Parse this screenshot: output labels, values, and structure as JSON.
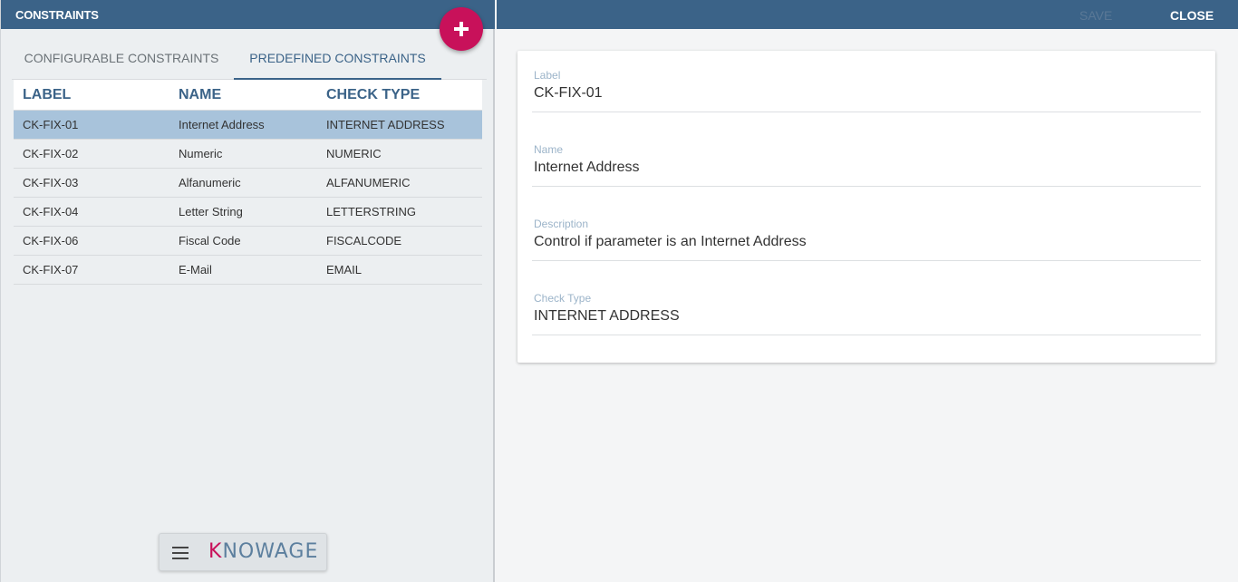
{
  "left": {
    "title": "CONSTRAINTS",
    "tabs": [
      {
        "label": "CONFIGURABLE CONSTRAINTS"
      },
      {
        "label": "PREDEFINED CONSTRAINTS"
      }
    ],
    "columns": [
      "LABEL",
      "NAME",
      "CHECK TYPE"
    ],
    "rows": [
      {
        "label": "CK-FIX-01",
        "name": "Internet Address",
        "check_type": "INTERNET ADDRESS"
      },
      {
        "label": "CK-FIX-02",
        "name": "Numeric",
        "check_type": "NUMERIC"
      },
      {
        "label": "CK-FIX-03",
        "name": "Alfanumeric",
        "check_type": "ALFANUMERIC"
      },
      {
        "label": "CK-FIX-04",
        "name": "Letter String",
        "check_type": "LETTERSTRING"
      },
      {
        "label": "CK-FIX-06",
        "name": "Fiscal Code",
        "check_type": "FISCALCODE"
      },
      {
        "label": "CK-FIX-07",
        "name": "E-Mail",
        "check_type": "EMAIL"
      }
    ],
    "logo_k": "K",
    "logo_rest": "NOWAGE"
  },
  "right": {
    "save_label": "SAVE",
    "close_label": "CLOSE",
    "fields": [
      {
        "label": "Label",
        "value": "CK-FIX-01"
      },
      {
        "label": "Name",
        "value": "Internet Address"
      },
      {
        "label": "Description",
        "value": "Control if parameter is an Internet Address"
      },
      {
        "label": "Check Type",
        "value": "INTERNET ADDRESS"
      }
    ]
  },
  "colors": {
    "toolbar": "#3b6388",
    "fab": "#c8115a",
    "selected_row": "#a8c3db"
  },
  "icons": {
    "fab": "plus-icon",
    "menu": "hamburger-menu-icon"
  }
}
